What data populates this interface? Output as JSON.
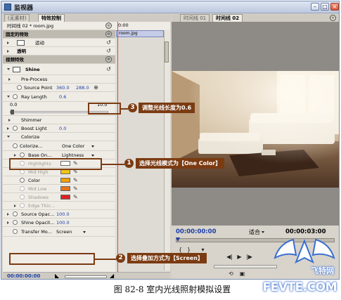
{
  "window": {
    "title": "监视器"
  },
  "left": {
    "tabs": [
      "(无素材)",
      "特效控制"
    ],
    "clip_title": "时间线 02 * room.jpg",
    "timeline_ruler": "0:00",
    "timeline_clip": "room.jpg",
    "fixed_effects": "固定的特效",
    "motion": "运动",
    "opacity": "透明",
    "video_effects": "视频特效",
    "shine": "Shine",
    "pre_process": "Pre-Process",
    "source_point_label": "Source Point",
    "source_point_x": "360.0",
    "source_point_y": "288.0",
    "ray_length_label": "Ray Length",
    "ray_length_value": "0.6",
    "slider_min": "0.0",
    "slider_max": "10.0",
    "shimmer": "Shimmer",
    "boost_light_label": "Boost Light",
    "boost_light_value": "0.0",
    "colorize": "Colorize",
    "colorize_sub_label": "Colorize...",
    "colorize_sub_value": "One Color",
    "base_on_label": "Base On...",
    "base_on_value": "Lightness",
    "color_rows": [
      {
        "label": "Highlights",
        "color": "#ffffff"
      },
      {
        "label": "Mid High",
        "color": "#f2c312"
      },
      {
        "label": "Color",
        "color": "#f0a000"
      },
      {
        "label": "Mid Low",
        "color": "#e7731c"
      },
      {
        "label": "Shadows",
        "color": "#e02020"
      }
    ],
    "edge_thickness": "Edge Thic...",
    "source_opacity_label": "Source Opac...",
    "source_opacity_value": "100.0",
    "shine_opacity_label": "Shine Opacit...",
    "shine_opacity_value": "100.0",
    "transfer_mode_label": "Transfer Mo...",
    "transfer_mode_value": "Screen",
    "bottom_time": "00:00:00:00"
  },
  "right": {
    "tabs": [
      "时间线 01",
      "时间线 02"
    ],
    "current_time": "00:00:00:00",
    "fit_label": "适合",
    "duration": "00:00:03:00"
  },
  "callouts": [
    {
      "num": "1",
      "text": "选择光线模式为【One Color】"
    },
    {
      "num": "2",
      "text": "选择叠加方式为【Screen】"
    },
    {
      "num": "3",
      "text": "调整光线长度为0.6"
    }
  ],
  "caption": "图 82-8   室内光线照射模拟设置",
  "watermark": {
    "line1": "飞特网",
    "line2": "FEVTE.COM"
  }
}
